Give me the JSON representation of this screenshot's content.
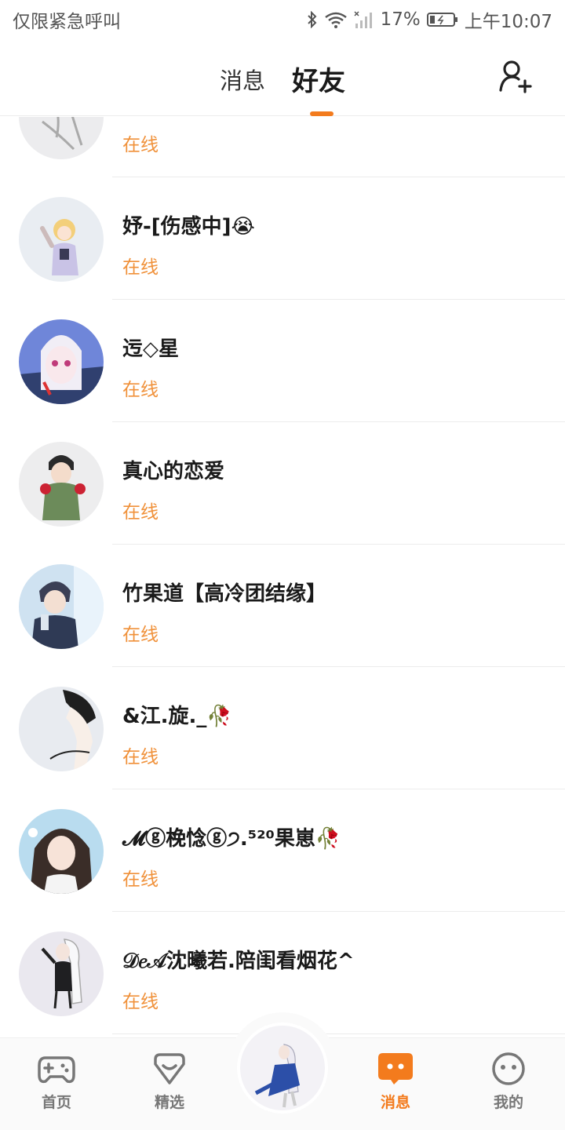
{
  "status_bar": {
    "carrier": "仅限紧急呼叫",
    "battery": "17%",
    "time": "上午10:07"
  },
  "header": {
    "tabs": [
      {
        "label": "消息",
        "active": false
      },
      {
        "label": "好友",
        "active": true
      }
    ],
    "accent": "#f37b1d"
  },
  "friends": [
    {
      "name": "",
      "status": "在线"
    },
    {
      "name": "妤-[伤感中]😭",
      "status": "在线"
    },
    {
      "name": "迃◇星",
      "status": "在线"
    },
    {
      "name": "真心的恋爱",
      "status": "在线"
    },
    {
      "name": "竹果道【高冷团结缘】",
      "status": "在线"
    },
    {
      "name": "&江.旋._🥀",
      "status": "在线"
    },
    {
      "name": "𝓜ⓖ梚惗ⓖ੭.⁵²⁰果崽🥀",
      "status": "在线"
    },
    {
      "name": "𝒟𝑒𝒜沈曦若.陪闺看烟花^",
      "status": "在线"
    }
  ],
  "bottom_nav": {
    "items": [
      {
        "label": "首页",
        "icon": "gamepad-icon"
      },
      {
        "label": "精选",
        "icon": "heart-chat-icon"
      },
      {
        "label": "消息",
        "icon": "message-bubble-icon",
        "active": true
      },
      {
        "label": "我的",
        "icon": "face-icon"
      }
    ]
  }
}
